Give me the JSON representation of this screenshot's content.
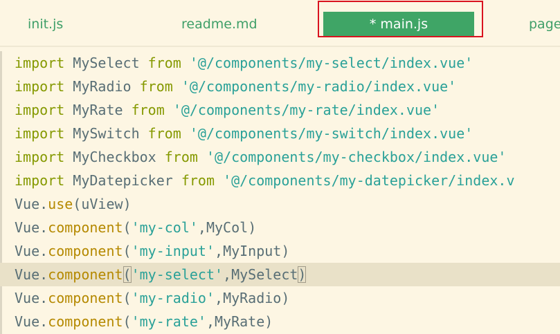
{
  "tabs": [
    {
      "label": "init.js",
      "active": false
    },
    {
      "label": "readme.md",
      "active": false
    },
    {
      "label": "* main.js",
      "active": true
    },
    {
      "label": "page"
    }
  ],
  "editor": {
    "lines": [
      {
        "kw": "import",
        "name": "MySelect",
        "from": "from",
        "path": "'@/components/my-select/index.vue'"
      },
      {
        "kw": "import",
        "name": "MyRadio",
        "from": "from",
        "path": "'@/components/my-radio/index.vue'"
      },
      {
        "kw": "import",
        "name": "MyRate",
        "from": "from",
        "path": "'@/components/my-rate/index.vue'"
      },
      {
        "kw": "import",
        "name": "MySwitch",
        "from": "from",
        "path": "'@/components/my-switch/index.vue'"
      },
      {
        "kw": "import",
        "name": "MyCheckbox",
        "from": "from",
        "path": "'@/components/my-checkbox/index.vue'"
      },
      {
        "kw": "import",
        "name": "MyDatepicker",
        "from": "from",
        "path": "'@/components/my-datepicker/index.v"
      },
      {
        "obj": "Vue",
        "dot": ".",
        "method": "use",
        "open": "(",
        "arg": "uView",
        "close": ")"
      },
      {
        "obj": "Vue",
        "dot": ".",
        "method": "component",
        "open": "(",
        "str": "'my-col'",
        "comma": ",",
        "arg": "MyCol",
        "close": ")"
      },
      {
        "obj": "Vue",
        "dot": ".",
        "method": "component",
        "open": "(",
        "str": "'my-input'",
        "comma": ",",
        "arg": "MyInput",
        "close": ")"
      },
      {
        "obj": "Vue",
        "dot": ".",
        "method": "component",
        "open": "(",
        "str": "'my-select'",
        "comma": ",",
        "arg": "MySelect",
        "close": ")",
        "current": true
      },
      {
        "obj": "Vue",
        "dot": ".",
        "method": "component",
        "open": "(",
        "str": "'my-radio'",
        "comma": ",",
        "arg": "MyRadio",
        "close": ")"
      },
      {
        "obj": "Vue",
        "dot": ".",
        "method": "component",
        "open": "(",
        "str": "'my-rate'",
        "comma": ",",
        "arg": "MyRate",
        "close": ")"
      }
    ]
  },
  "colors": {
    "background": "#fdf6e3",
    "active_tab": "#3fa566",
    "tab_text": "#3f9f68",
    "highlight_box": "#d9131f",
    "keyword": "#859900",
    "string": "#2aa198",
    "method": "#b58900",
    "current_line": "#e9e1c8"
  }
}
